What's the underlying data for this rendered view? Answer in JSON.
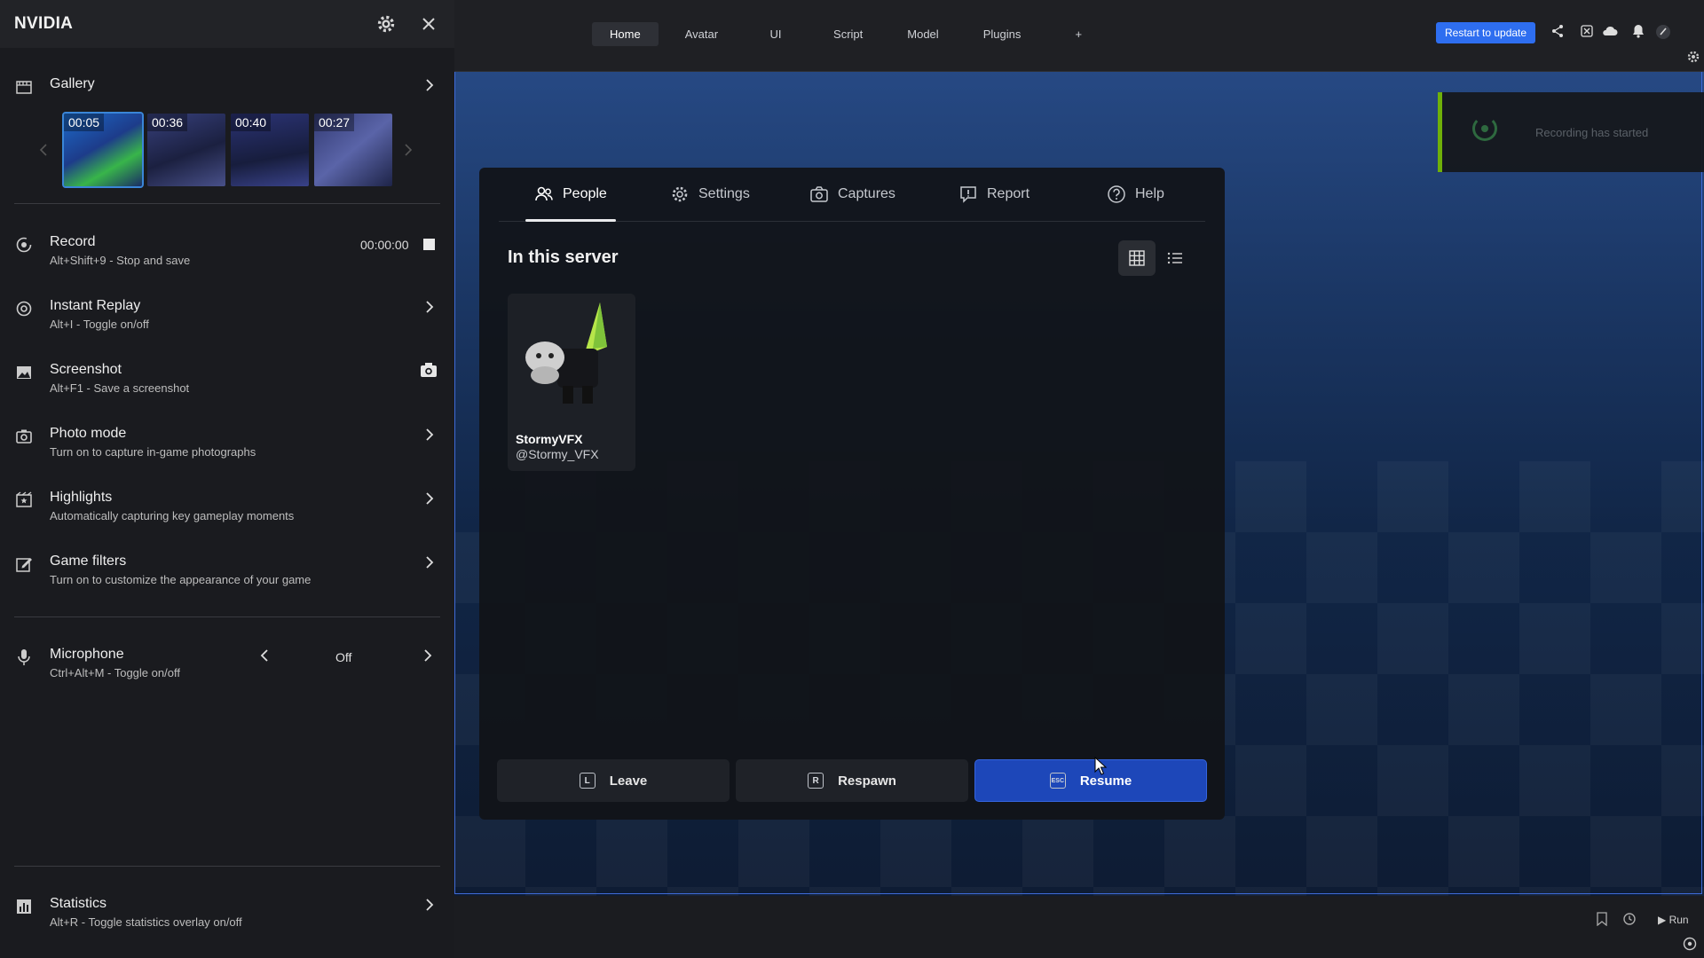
{
  "studio": {
    "tabs": [
      "Home",
      "Avatar",
      "UI",
      "Script",
      "Model",
      "Plugins",
      "+"
    ],
    "active_tab": "Home",
    "restart_label": "Restart to update",
    "run_label": "Run"
  },
  "toast": {
    "message": "Recording has started"
  },
  "menu": {
    "tabs": [
      {
        "label": "People",
        "icon": "people-icon"
      },
      {
        "label": "Settings",
        "icon": "gear-icon"
      },
      {
        "label": "Captures",
        "icon": "camera-icon"
      },
      {
        "label": "Report",
        "icon": "report-flag-icon"
      },
      {
        "label": "Help",
        "icon": "help-icon"
      }
    ],
    "active_tab": "People",
    "section_title": "In this server",
    "player": {
      "name": "StormyVFX",
      "handle": "@Stormy_VFX"
    },
    "buttons": {
      "leave": {
        "label": "Leave",
        "key": "L"
      },
      "respawn": {
        "label": "Respawn",
        "key": "R"
      },
      "resume": {
        "label": "Resume",
        "key": "ESC"
      }
    }
  },
  "nvidia": {
    "title": "NVIDIA",
    "gallery": {
      "label": "Gallery",
      "thumbnails": [
        "00:05",
        "00:36",
        "00:40",
        "00:27"
      ]
    },
    "record": {
      "label": "Record",
      "sub": "Alt+Shift+9 - Stop and save",
      "time": "00:00:00"
    },
    "instant_replay": {
      "label": "Instant Replay",
      "sub": "Alt+I - Toggle on/off"
    },
    "screenshot": {
      "label": "Screenshot",
      "sub": "Alt+F1 - Save a screenshot"
    },
    "photo_mode": {
      "label": "Photo mode",
      "sub": "Turn on to capture in-game photographs"
    },
    "highlights": {
      "label": "Highlights",
      "sub": "Automatically capturing key gameplay moments"
    },
    "game_filters": {
      "label": "Game filters",
      "sub": "Turn on to customize the appearance of your game"
    },
    "microphone": {
      "label": "Microphone",
      "sub": "Ctrl+Alt+M - Toggle on/off",
      "state": "Off"
    },
    "statistics": {
      "label": "Statistics",
      "sub": "Alt+R - Toggle statistics overlay on/off"
    }
  },
  "colors": {
    "nvidia_green": "#76b900",
    "accent_blue": "#2e6ef0",
    "resume_blue": "#1d47b9"
  }
}
